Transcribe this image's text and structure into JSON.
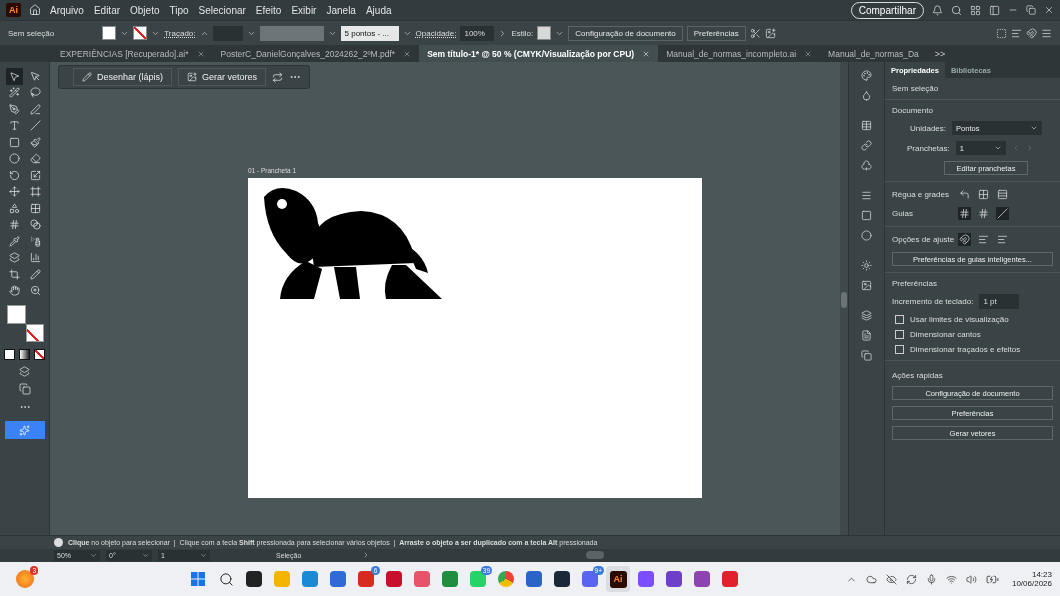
{
  "app": {
    "logo": "Ai"
  },
  "menu": [
    "Arquivo",
    "Editar",
    "Objeto",
    "Tipo",
    "Selecionar",
    "Efeito",
    "Exibir",
    "Janela",
    "Ajuda"
  ],
  "share_button": "Compartilhar",
  "control_bar": {
    "selection": "Sem seleção",
    "stroke_label": "Traçado:",
    "brush": "5 pontos - ...",
    "opacity_label": "Opacidade:",
    "opacity": "100%",
    "style_label": "Estilo:",
    "buttons": [
      "Configuração de documento",
      "Preferências"
    ]
  },
  "tabs": [
    {
      "label": "EXPERIÊNCIAS [Recuperado].ai*",
      "selected": false
    },
    {
      "label": "PosterC_DanielGonçalves_2024262_2ºM.pdf*",
      "selected": false
    },
    {
      "label": "Sem título-1* @ 50 % (CMYK/Visualização por CPU)",
      "selected": true
    },
    {
      "label": "Manual_de_normas_incompleto.ai",
      "selected": false
    },
    {
      "label": "Manual_de_normas_Da",
      "selected": false
    }
  ],
  "tabs_overflow": ">>",
  "tools": [
    {
      "selected": true
    },
    {
      "selected": false
    },
    {
      "selected": false
    },
    {
      "selected": false
    },
    {
      "selected": false
    },
    {
      "selected": false
    },
    {
      "selected": false
    },
    {
      "selected": false
    },
    {
      "selected": false
    },
    {
      "selected": false
    },
    {
      "selected": false
    },
    {
      "selected": false
    },
    {
      "selected": false
    },
    {
      "selected": false
    },
    {
      "selected": false
    },
    {
      "selected": false
    },
    {
      "selected": false
    },
    {
      "selected": false
    },
    {
      "selected": false
    },
    {
      "selected": false
    },
    {
      "selected": false
    },
    {
      "selected": false
    },
    {
      "selected": false
    },
    {
      "selected": false
    },
    {
      "selected": false
    },
    {
      "selected": false
    },
    {
      "selected": false
    },
    {
      "selected": false
    }
  ],
  "context_bar": {
    "buttons": [
      "Desenhar (lápis)",
      "Gerar vetores"
    ]
  },
  "artboard": {
    "label": "01 - Prancheta 1"
  },
  "panel": {
    "tabs": [
      {
        "label": "Propriedades",
        "selected": true
      },
      {
        "label": "Bibliotecas",
        "selected": false
      }
    ],
    "selection": "Sem seleção",
    "document": {
      "title": "Documento",
      "units_label": "Unidades:",
      "units": "Pontos",
      "artboards_label": "Pranchetas:",
      "artboard": "1",
      "edit_button": "Editar pranchetas"
    },
    "rulers_label": "Régua e grades",
    "guides_label": "Guias",
    "snap_label": "Opções de ajuste",
    "smart_guides_button": "Preferências de guias inteligentes...",
    "preferences": {
      "title": "Preferências",
      "increment_label": "Incremento de teclado:",
      "increment": "1 pt",
      "options": [
        {
          "label": "Usar limites de visualização",
          "checked": false
        },
        {
          "label": "Dimensionar cantos",
          "checked": false
        },
        {
          "label": "Dimensionar traçados e efeitos",
          "checked": false
        }
      ]
    },
    "quick_actions": {
      "title": "Ações rápidas",
      "buttons": [
        "Configuração de documento",
        "Preferências",
        "Gerar vetores"
      ]
    }
  },
  "status": {
    "hint": "**Clique** no objeto para selecionar  |  Clique com a tecla **Shift** pressionada para selecionar vários objetos  |  **Arraste o objeto a ser duplicado com a tecla Alt** pressionada",
    "zoom": "50%",
    "rotation": "0°",
    "artboard": "1",
    "tool": "Seleção"
  },
  "taskbar": {
    "widget_badge": "3",
    "apps": [
      {
        "selected": false
      },
      {
        "selected": false
      },
      {
        "selected": false
      },
      {
        "selected": false
      },
      {
        "selected": false
      },
      {
        "selected": false
      },
      {
        "selected": false,
        "badge": "6"
      },
      {
        "selected": false
      },
      {
        "selected": false
      },
      {
        "selected": false
      },
      {
        "selected": false,
        "badge": "39"
      },
      {
        "selected": false
      },
      {
        "selected": false
      },
      {
        "selected": false
      },
      {
        "selected": false,
        "badge": "9+"
      },
      {
        "selected": true,
        "label": "Ai"
      },
      {
        "selected": false
      },
      {
        "selected": false
      },
      {
        "selected": false
      },
      {
        "selected": false
      }
    ],
    "time": "14:23",
    "date": "10/06/2026"
  }
}
